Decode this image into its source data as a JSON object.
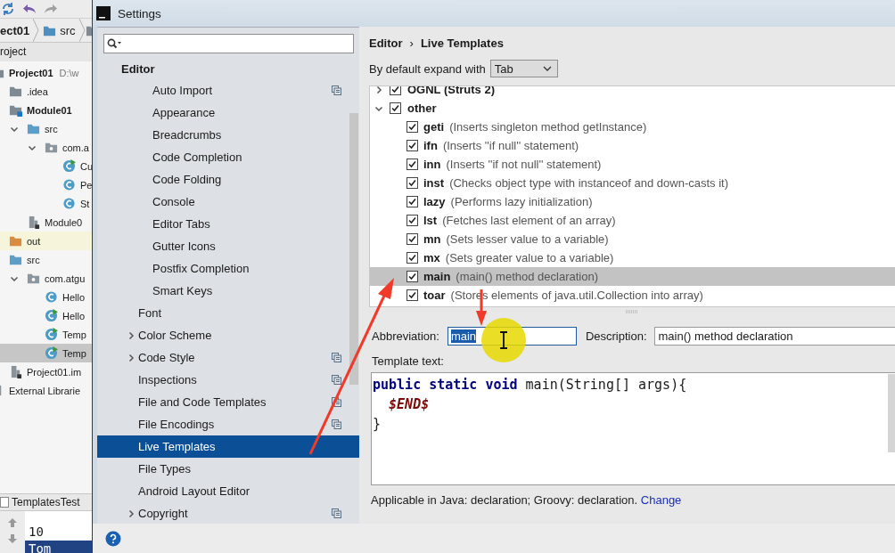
{
  "ide": {
    "breadcrumbs": [
      "ect01",
      "src"
    ],
    "project_header": "roject",
    "tree": [
      {
        "label": "Project01",
        "note": "D:\\w",
        "kind": "project",
        "bold": true,
        "selected": false,
        "children": [
          {
            "label": ".idea",
            "kind": "folder",
            "bold": false,
            "selected": false
          },
          {
            "label": "Module01",
            "kind": "module",
            "bold": true,
            "selected": false,
            "children": [
              {
                "label": "src",
                "kind": "source-folder",
                "bold": false,
                "expanded": true,
                "selected": false,
                "children": [
                  {
                    "label": "com.a",
                    "kind": "package",
                    "bold": false,
                    "expanded": true,
                    "selected": false,
                    "children": [
                      {
                        "label": "Cu",
                        "kind": "runnable-class",
                        "bold": false,
                        "selected": false
                      },
                      {
                        "label": "Pe",
                        "kind": "class",
                        "bold": false,
                        "selected": false
                      },
                      {
                        "label": "St",
                        "kind": "class",
                        "bold": false,
                        "selected": false
                      }
                    ]
                  }
                ]
              },
              {
                "label": "Module0",
                "kind": "module-file",
                "bold": false,
                "selected": false
              }
            ]
          },
          {
            "label": "out",
            "kind": "excluded-folder",
            "bold": false,
            "selected": false
          },
          {
            "label": "src",
            "kind": "source-folder",
            "bold": false,
            "selected": false,
            "children": [
              {
                "label": "com.atgu",
                "kind": "package",
                "bold": false,
                "expanded": true,
                "selected": false,
                "children": [
                  {
                    "label": "Hello",
                    "kind": "class",
                    "bold": false,
                    "selected": false
                  },
                  {
                    "label": "Hello",
                    "kind": "runnable-class",
                    "bold": false,
                    "selected": false
                  },
                  {
                    "label": "Temp",
                    "kind": "runnable-class",
                    "bold": false,
                    "selected": false
                  },
                  {
                    "label": "Temp",
                    "kind": "runnable-class",
                    "bold": false,
                    "selected": true
                  }
                ]
              }
            ]
          },
          {
            "label": "Project01.im",
            "kind": "module-file",
            "bold": false,
            "selected": false
          }
        ]
      },
      {
        "label": "External Librarie",
        "kind": "libraries",
        "bold": false,
        "selected": false
      }
    ],
    "run_tab": "TemplatesTest",
    "console_lines": [
      {
        "text": "10",
        "selected": false
      },
      {
        "text": "Tom",
        "selected": true
      }
    ]
  },
  "window": {
    "title": "Settings"
  },
  "sidebar": {
    "header": "Editor",
    "items": [
      {
        "kind": "group",
        "children": [
          {
            "label": "Auto Import",
            "selected": false,
            "project_level": true
          },
          {
            "label": "Appearance",
            "selected": false,
            "project_level": false
          },
          {
            "label": "Breadcrumbs",
            "selected": false,
            "project_level": false
          },
          {
            "label": "Code Completion",
            "selected": false,
            "project_level": false
          },
          {
            "label": "Code Folding",
            "selected": false,
            "project_level": false
          },
          {
            "label": "Console",
            "selected": false,
            "project_level": false
          },
          {
            "label": "Editor Tabs",
            "selected": false,
            "project_level": false
          },
          {
            "label": "Gutter Icons",
            "selected": false,
            "project_level": false
          },
          {
            "label": "Postfix Completion",
            "selected": false,
            "project_level": false
          },
          {
            "label": "Smart Keys",
            "selected": false,
            "project_level": false
          }
        ]
      },
      {
        "kind": "item",
        "label": "Font",
        "selected": false,
        "project_level": false
      },
      {
        "kind": "item",
        "label": "Color Scheme",
        "selected": false,
        "project_level": false,
        "expanded": false
      },
      {
        "kind": "item",
        "label": "Code Style",
        "selected": false,
        "project_level": true,
        "expanded": false
      },
      {
        "kind": "item",
        "label": "Inspections",
        "selected": false,
        "project_level": true
      },
      {
        "kind": "item",
        "label": "File and Code Templates",
        "selected": false,
        "project_level": true
      },
      {
        "kind": "item",
        "label": "File Encodings",
        "selected": false,
        "project_level": true
      },
      {
        "kind": "item",
        "label": "Live Templates",
        "selected": true,
        "project_level": false
      },
      {
        "kind": "item",
        "label": "File Types",
        "selected": false,
        "project_level": false
      },
      {
        "kind": "item",
        "label": "Android Layout Editor",
        "selected": false,
        "project_level": false
      },
      {
        "kind": "item",
        "label": "Copyright",
        "selected": false,
        "project_level": true,
        "expanded": false
      }
    ]
  },
  "content": {
    "breadcrumb": [
      "Editor",
      "Live Templates"
    ],
    "breadcrumb_separator": "›",
    "expand_with": {
      "label": "By default expand with",
      "value": "Tab"
    },
    "template_groups": [
      {
        "name": "OGNL (Struts 2)",
        "checked": true,
        "expanded": false
      },
      {
        "name": "other",
        "checked": true,
        "expanded": true,
        "children": [
          {
            "abbreviation": "geti",
            "description": "(Inserts singleton method getInstance)",
            "checked": true,
            "selected": false
          },
          {
            "abbreviation": "ifn",
            "description": "(Inserts ''if null'' statement)",
            "checked": true,
            "selected": false
          },
          {
            "abbreviation": "inn",
            "description": "(Inserts ''if not null'' statement)",
            "checked": true,
            "selected": false
          },
          {
            "abbreviation": "inst",
            "description": "(Checks object type with instanceof and down-casts it)",
            "checked": true,
            "selected": false
          },
          {
            "abbreviation": "lazy",
            "description": "(Performs lazy initialization)",
            "checked": true,
            "selected": false
          },
          {
            "abbreviation": "lst",
            "description": "(Fetches last element of an array)",
            "checked": true,
            "selected": false
          },
          {
            "abbreviation": "mn",
            "description": "(Sets lesser value to a variable)",
            "checked": true,
            "selected": false
          },
          {
            "abbreviation": "mx",
            "description": "(Sets greater value to a variable)",
            "checked": true,
            "selected": false
          },
          {
            "abbreviation": "main",
            "description": "(main() method declaration)",
            "checked": true,
            "selected": true
          },
          {
            "abbreviation": "toar",
            "description": "(Stores elements of java.util.Collection into array)",
            "checked": true,
            "selected": false
          }
        ]
      }
    ],
    "abbreviation": {
      "label": "Abbreviation:",
      "value": "main",
      "text_selected": true
    },
    "description": {
      "label": "Description:",
      "value": "main() method declaration"
    },
    "template_text": {
      "label": "Template text:",
      "lines": [
        [
          {
            "kind": "keyword",
            "text": "public static void"
          },
          {
            "kind": "plain",
            "text": " main(String[] args){"
          }
        ],
        [
          {
            "kind": "variable",
            "text": "  $END$"
          }
        ],
        [
          {
            "kind": "plain",
            "text": "}"
          }
        ]
      ]
    },
    "applicable": {
      "text": "Applicable in Java: declaration; Groovy: declaration.",
      "link": "Change"
    }
  }
}
